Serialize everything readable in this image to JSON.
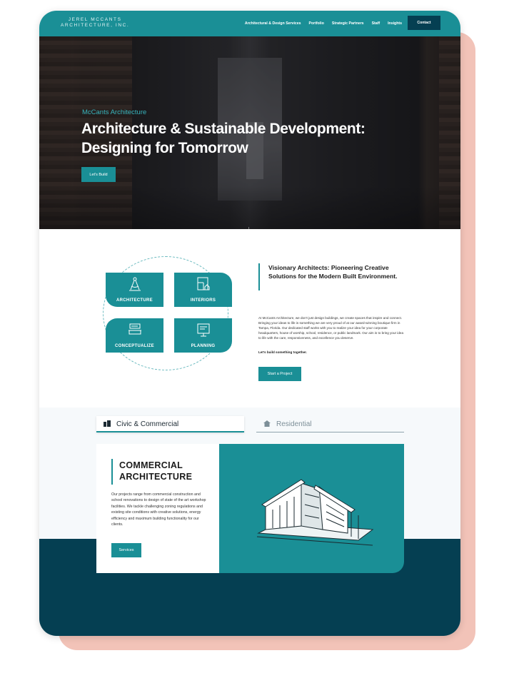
{
  "nav": {
    "logo_line1": "JEREL MCCANTS",
    "logo_line2": "ARCHITECTURE, INC.",
    "links": [
      "Architectural & Design Services",
      "Portfolio",
      "Strategic Partners",
      "Staff",
      "Insights"
    ],
    "contact_label": "Contact"
  },
  "hero": {
    "subtitle": "McCants Architecture",
    "title_line1": "Architecture & Sustainable Development:",
    "title_line2": "Designing for Tomorrow",
    "cta_label": "Let's Build",
    "scroll_arrow": "↓"
  },
  "services": {
    "tiles": [
      "ARCHITECTURE",
      "INTERIORS",
      "CONCEPTUALIZE",
      "PLANNING"
    ]
  },
  "about": {
    "title": "Visionary Architects: Pioneering Creative Solutions for the Modern Built Environment.",
    "body": "At McCants Architecture, we don't just design buildings, we create spaces that inspire and connect. Bringing your ideas to life is something we are very proud of at our award-winning boutique firm in Tampa, Florida. Our dedicated staff works with you to realize your idea for your corporate headquarters, house of worship, school, residence, or public landmark. Our aim is to bring your idea to life with the care, responsiveness, and excellence you deserve.",
    "tagline": "Let's build something together.",
    "cta_label": "Start a Project"
  },
  "tabs": {
    "active_label": "Civic & Commercial",
    "inactive_label": "Residential"
  },
  "project": {
    "title_line1": "COMMERCIAL",
    "title_line2": "ARCHITECTURE",
    "body": "Our projects range from commercial construction and school renovations to design of state of the art workshop facilities. We tackle challenging zoning regulations and existing site conditions with creative solutions, energy efficiency and maximum building functionality for our clients.",
    "cta_label": "Services"
  },
  "colors": {
    "teal": "#1a8f96",
    "navy": "#053f52",
    "accent_shadow": "#f2c3b8"
  }
}
